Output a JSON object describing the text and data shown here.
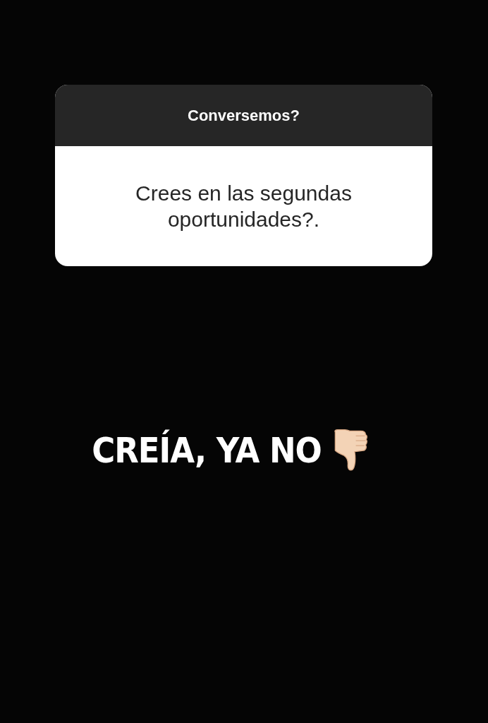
{
  "question_sticker": {
    "title": "Conversemos?",
    "question": "Crees en las segundas oportunidades?."
  },
  "answer": {
    "text": "CREÍA, YA NO"
  }
}
